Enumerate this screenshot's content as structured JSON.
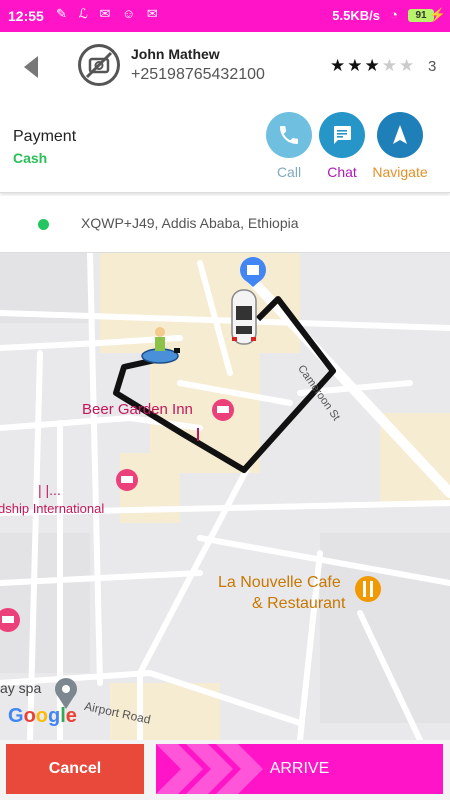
{
  "status_bar": {
    "time": "12:55",
    "network_speed": "5.5KB/s",
    "battery": "91"
  },
  "driver": {
    "name": "John Mathew",
    "phone": "+25198765432100",
    "rating": 3,
    "rating_max": 5,
    "rating_text": "3"
  },
  "payment": {
    "title": "Payment",
    "method": "Cash",
    "method_color": "#2bbf58"
  },
  "actions": {
    "call_label": "Call",
    "chat_label": "Chat",
    "navigate_label": "Navigate"
  },
  "address": {
    "text": "XQWP+J49, Addis Ababa, Ethiopia"
  },
  "map": {
    "pois": {
      "beer_garden": "Beer Garden Inn",
      "friendship": "dship International",
      "friendship_bars": "|      |...",
      "cafe_line1": "La Nouvelle Cafe",
      "cafe_line2": "& Restaurant",
      "spa": "ay spa"
    },
    "streets": {
      "cameroon": "Cameroon St",
      "airport": "Airport Road"
    },
    "logo": [
      "G",
      "o",
      "o",
      "g",
      "l",
      "e"
    ]
  },
  "buttons": {
    "cancel": "Cancel",
    "arrive": "ARRIVE"
  },
  "colors": {
    "brand": "#ff14c8",
    "cancel": "#e8493b",
    "route": "#111111"
  }
}
